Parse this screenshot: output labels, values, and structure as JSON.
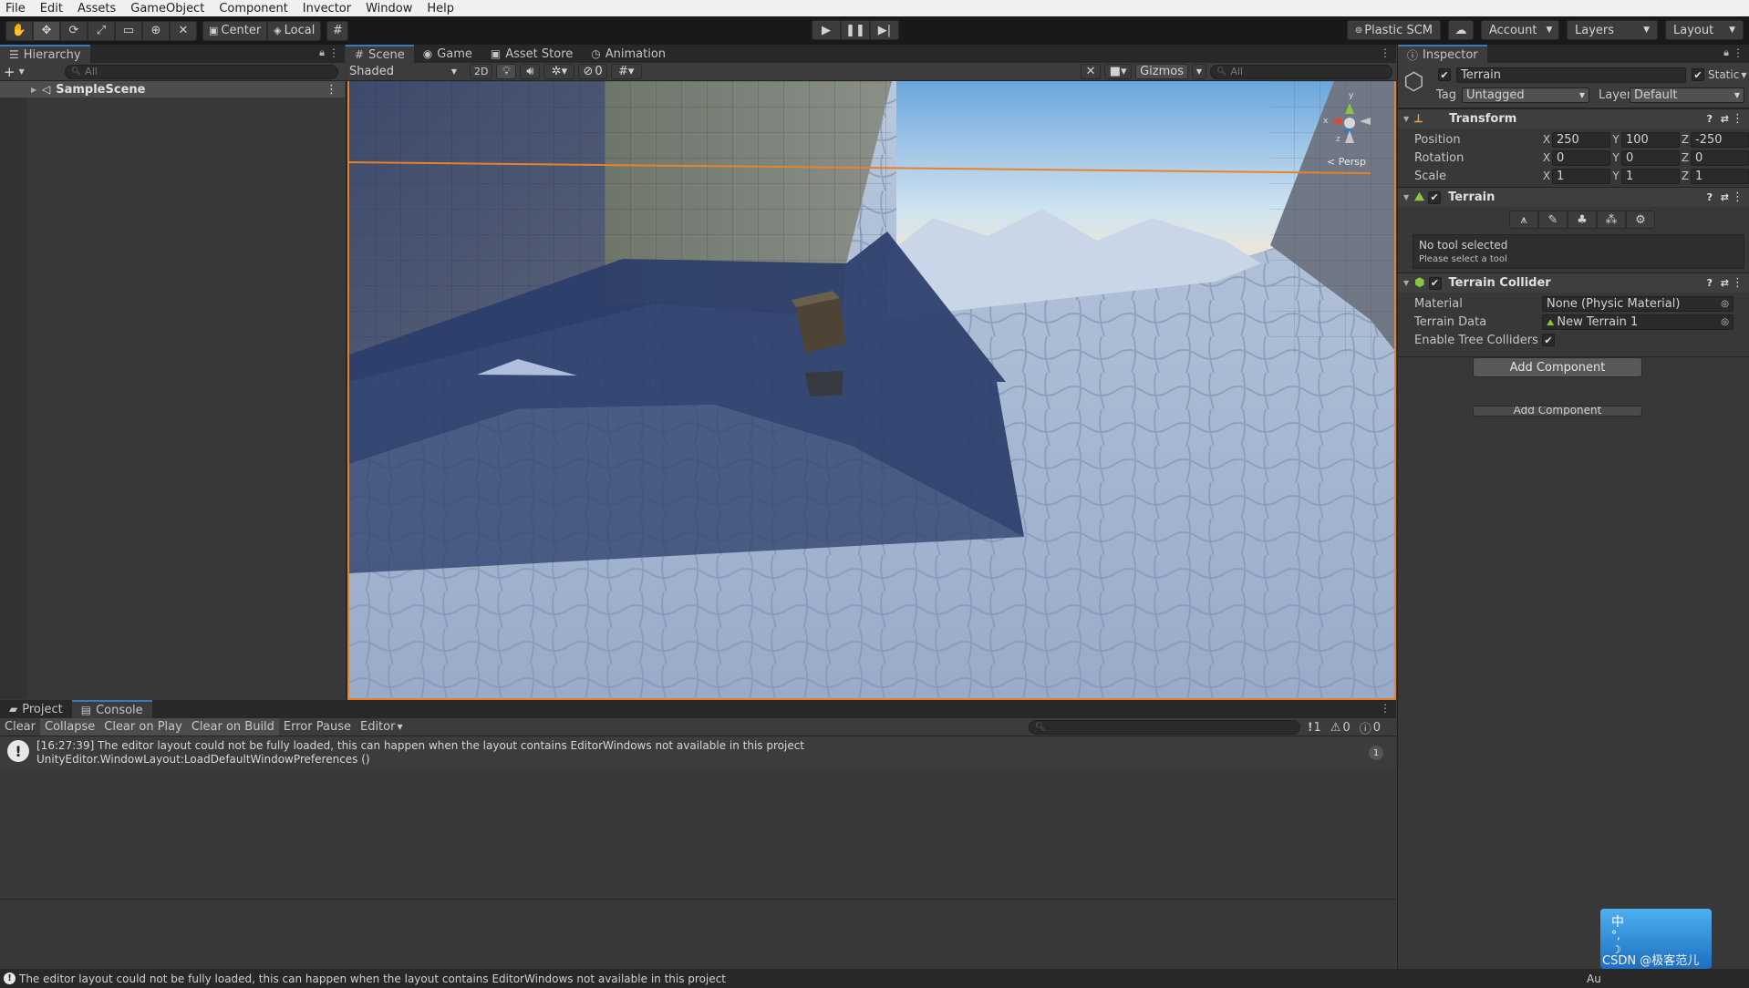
{
  "menu": [
    "File",
    "Edit",
    "Assets",
    "GameObject",
    "Component",
    "Invector",
    "Window",
    "Help"
  ],
  "toolbar": {
    "pivot_label": "Center",
    "space_label": "Local",
    "plastic_label": "Plastic SCM",
    "account_label": "Account",
    "layers_label": "Layers",
    "layout_label": "Layout"
  },
  "hierarchy": {
    "tab_label": "Hierarchy",
    "search_placeholder": "All",
    "scene_name": "SampleScene"
  },
  "scene": {
    "tabs": [
      "Scene",
      "Game",
      "Asset Store",
      "Animation"
    ],
    "shading_mode": "Shaded",
    "mode_2d": "2D",
    "hidden_count": "0",
    "gizmos_label": "Gizmos",
    "search_placeholder": "All",
    "persp_label": "Persp",
    "gizmo_axes": {
      "x": "x",
      "y": "y",
      "z": "z"
    }
  },
  "inspector": {
    "tab_label": "Inspector",
    "object_name": "Terrain",
    "static_label": "Static",
    "tag_label": "Tag",
    "tag_value": "Untagged",
    "layer_label": "Layer",
    "layer_value": "Default",
    "transform": {
      "title": "Transform",
      "rows": [
        {
          "label": "Position",
          "x": "250",
          "y": "100",
          "z": "-250"
        },
        {
          "label": "Rotation",
          "x": "0",
          "y": "0",
          "z": "0"
        },
        {
          "label": "Scale",
          "x": "1",
          "y": "1",
          "z": "1"
        }
      ]
    },
    "terrain": {
      "title": "Terrain",
      "no_tool": "No tool selected",
      "hint": "Please select a tool"
    },
    "collider": {
      "title": "Terrain Collider",
      "material_label": "Material",
      "material_value": "None (Physic Material)",
      "data_label": "Terrain Data",
      "data_value": "New Terrain 1",
      "trees_label": "Enable Tree Colliders"
    },
    "add_component": "Add Component",
    "add_component_ghost": "Add Component"
  },
  "console": {
    "tabs": [
      "Project",
      "Console"
    ],
    "buttons": [
      "Clear",
      "Collapse",
      "Clear on Play",
      "Clear on Build",
      "Error Pause"
    ],
    "editor_dropdown": "Editor",
    "counts": {
      "errors": "1",
      "warnings": "0",
      "infos": "0"
    },
    "message_line1": "[16:27:39] The editor layout could not be fully loaded, this can happen when the layout contains EditorWindows not available in this project",
    "message_line2": "UnityEditor.WindowLayout:LoadDefaultWindowPreferences ()",
    "message_count": "1"
  },
  "status": {
    "message": "The editor layout could not be fully loaded, this can happen when the layout contains EditorWindows not available in this project",
    "auto_label": "Au"
  },
  "widget": {
    "ime_char": "中",
    "watermark": "CSDN @极客范儿"
  },
  "colors": {
    "accent": "#3a79bb",
    "selection_outline": "#e8812a",
    "panel_bg": "#383838",
    "toolbar_bg": "#191919"
  }
}
